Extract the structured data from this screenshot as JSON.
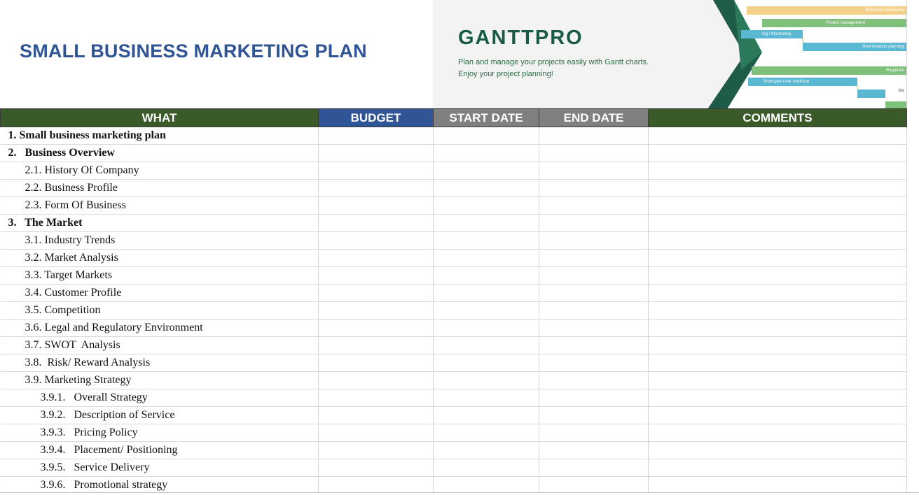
{
  "sheet": {
    "title": "SMALL BUSINESS MARKETING PLAN"
  },
  "banner": {
    "logo": "GANTTPRO",
    "tagline_line1": "Plan and manage your projects easily with Gantt charts.",
    "tagline_line2": "Enjoy your project planning!",
    "bars": [
      "Software Developme",
      "Project management",
      "ing / Monitoring",
      "Next iteration planning",
      "Requirem",
      "Prototype User Interface",
      "Ma"
    ]
  },
  "colors": {
    "title": "#2f5597",
    "header_green": "#3a5a2a",
    "header_blue": "#2f5597",
    "header_gray": "#808080",
    "brand_green": "#1a5b45"
  },
  "table": {
    "headers": {
      "what": "WHAT",
      "budget": "BUDGET",
      "start_date": "START DATE",
      "end_date": "END DATE",
      "comments": "COMMENTS"
    },
    "rows": [
      {
        "level": 1,
        "text": "1. Small business marketing plan"
      },
      {
        "level": 1,
        "text": "2.   Business Overview"
      },
      {
        "level": 2,
        "text": "2.1. History Of Company"
      },
      {
        "level": 2,
        "text": "2.2. Business Profile"
      },
      {
        "level": 2,
        "text": "2.3. Form Of Business"
      },
      {
        "level": 1,
        "text": "3.   The Market"
      },
      {
        "level": 2,
        "text": "3.1. Industry Trends"
      },
      {
        "level": 2,
        "text": "3.2. Market Analysis"
      },
      {
        "level": 2,
        "text": "3.3. Target Markets"
      },
      {
        "level": 2,
        "text": "3.4. Customer Profile"
      },
      {
        "level": 2,
        "text": "3.5. Competition"
      },
      {
        "level": 2,
        "text": "3.6. Legal and Regulatory Environment"
      },
      {
        "level": 2,
        "text": "3.7. SWOT  Analysis"
      },
      {
        "level": 2,
        "text": "3.8.  Risk/ Reward Analysis"
      },
      {
        "level": 2,
        "text": "3.9. Marketing Strategy"
      },
      {
        "level": 3,
        "text": "3.9.1.   Overall Strategy"
      },
      {
        "level": 3,
        "text": "3.9.2.   Description of Service"
      },
      {
        "level": 3,
        "text": "3.9.3.   Pricing Policy"
      },
      {
        "level": 3,
        "text": "3.9.4.   Placement/ Positioning"
      },
      {
        "level": 3,
        "text": "3.9.5.   Service Delivery"
      },
      {
        "level": 3,
        "text": "3.9.6.   Promotional strategy"
      }
    ]
  }
}
